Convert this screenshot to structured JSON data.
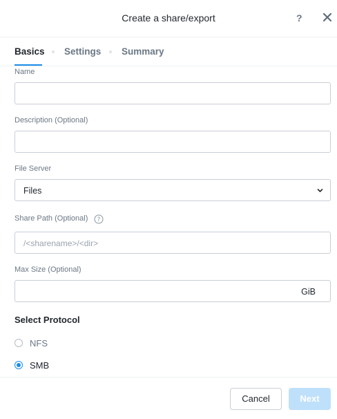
{
  "dialog": {
    "title": "Create a share/export",
    "help_label": "?"
  },
  "tabs": [
    {
      "label": "Basics",
      "active": true
    },
    {
      "label": "Settings",
      "active": false
    },
    {
      "label": "Summary",
      "active": false
    }
  ],
  "form": {
    "name": {
      "label": "Name",
      "value": ""
    },
    "description": {
      "label": "Description (Optional)",
      "value": ""
    },
    "file_server": {
      "label": "File Server",
      "selected": "Files"
    },
    "share_path": {
      "label": "Share Path (Optional)",
      "placeholder": "/<sharename>/<dir>"
    },
    "max_size": {
      "label": "Max Size (Optional)",
      "value": "",
      "unit": "GiB"
    }
  },
  "protocol": {
    "title": "Select Protocol",
    "options": [
      {
        "label": "NFS",
        "checked": false
      },
      {
        "label": "SMB",
        "checked": true
      }
    ]
  },
  "footer": {
    "cancel_label": "Cancel",
    "next_label": "Next"
  },
  "colors": {
    "accent": "#1b8ce8",
    "disabled_button": "#bfe0fa"
  }
}
